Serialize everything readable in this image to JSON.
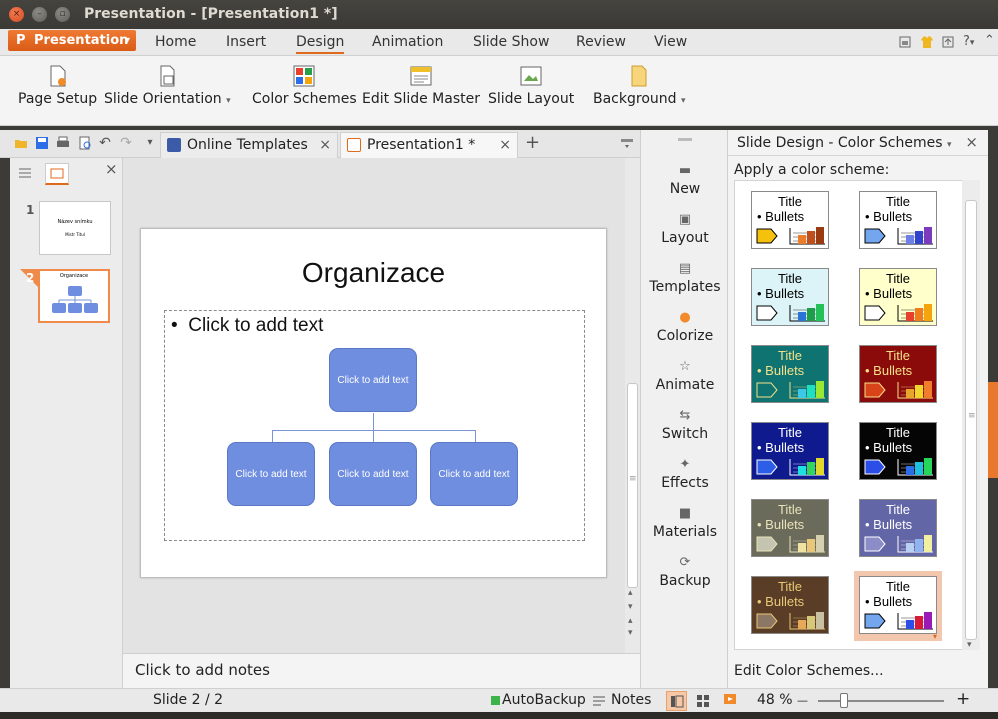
{
  "window": {
    "title": "Presentation - [Presentation1 *]",
    "close_glyph": "×",
    "min_glyph": "–",
    "max_glyph": "▫"
  },
  "menubar": {
    "app_button": "Presentation",
    "app_icon": "P",
    "app_arrow": "▾",
    "tabs": [
      "Home",
      "Insert",
      "Design",
      "Animation",
      "Slide Show",
      "Review",
      "View"
    ],
    "active_tab": "Design",
    "help_glyph": "?",
    "help_arrow": "▾",
    "collapse_glyph": "⌃"
  },
  "ribbon": {
    "buttons": [
      {
        "label": "Page Setup",
        "dropdown": false
      },
      {
        "label": "Slide Orientation",
        "dropdown": true
      },
      {
        "label": "Color Schemes",
        "dropdown": false
      },
      {
        "label": "Edit Slide Master",
        "dropdown": false
      },
      {
        "label": "Slide Layout",
        "dropdown": false
      },
      {
        "label": "Background",
        "dropdown": true
      }
    ],
    "dropdown_glyph": "▾"
  },
  "doc_tabs": {
    "tabs": [
      {
        "label": "Online Templates",
        "active": false
      },
      {
        "label": "Presentation1 *",
        "active": true
      }
    ],
    "close_glyph": "×",
    "new_tab_glyph": "+",
    "quick_access": {
      "undo": "↶",
      "redo": "↷",
      "more": "▾"
    }
  },
  "thumbnails": {
    "close_glyph": "×",
    "slides": [
      {
        "number": "1",
        "title": "Název snímku",
        "subtitle": "Mistr Titul"
      },
      {
        "number": "2",
        "title": "Organizace",
        "selected": true
      }
    ]
  },
  "slide": {
    "title": "Organizace",
    "bullet": "•",
    "body_text": "Click to add text",
    "org_boxes": [
      "Click to add text",
      "Click to add text",
      "Click to add text",
      "Click to add text"
    ],
    "shape_fill": "#6f8ee0"
  },
  "scroll": {
    "up": "▴",
    "down": "▾",
    "grip": "≡"
  },
  "notes": {
    "placeholder": "Click to add notes"
  },
  "side_tools": {
    "items": [
      "New",
      "Layout",
      "Templates",
      "Colorize",
      "Animate",
      "Switch",
      "Effects",
      "Materials",
      "Backup"
    ],
    "icons": [
      "▬",
      "▣",
      "▤",
      "●",
      "☆",
      "⇆",
      "✦",
      "■",
      "⟳"
    ],
    "grip": "▬"
  },
  "task_pane": {
    "title": "Slide Design - Color Schemes",
    "title_arrow": "▾",
    "close_glyph": "×",
    "subtitle": "Apply a color scheme:",
    "scheme_title": "Title",
    "scheme_bullets": "• Bullets",
    "edit_link": "Edit Color Schemes...",
    "selected_marker": "▾",
    "schemes": [
      {
        "bg": "#ffffff",
        "text": "#000000",
        "arrow": "#f4c20d",
        "bars": [
          "#e87d2b",
          "#c0501b",
          "#9a3a10"
        ]
      },
      {
        "bg": "#ffffff",
        "text": "#000000",
        "arrow": "#74a6f0",
        "bars": [
          "#6c80e8",
          "#3344cc",
          "#7b3bbd"
        ]
      },
      {
        "bg": "#dcf3f7",
        "text": "#000000",
        "arrow": "#ffffff",
        "bars": [
          "#2c73d6",
          "#1d9e4a",
          "#26c05a"
        ]
      },
      {
        "bg": "#ffffcc",
        "text": "#000000",
        "arrow": "#ffffff",
        "bars": [
          "#e8412b",
          "#f07d1c",
          "#f4a40d"
        ]
      },
      {
        "bg": "#0f7371",
        "text": "#f4e08a",
        "arrow": "#0f7371",
        "bars": [
          "#3ec8e8",
          "#1ee0c0",
          "#9be832"
        ]
      },
      {
        "bg": "#8b0a0a",
        "text": "#f4e08a",
        "arrow": "#d8431a",
        "bars": [
          "#e8a52b",
          "#f0d52b",
          "#f07d2b"
        ]
      },
      {
        "bg": "#0e1a8e",
        "text": "#ffffff",
        "arrow": "#2c5ee8",
        "bars": [
          "#1ee0e0",
          "#32d65a",
          "#e0d82b"
        ]
      },
      {
        "bg": "#050505",
        "text": "#ffffff",
        "arrow": "#2c4ee8",
        "bars": [
          "#2c6ee8",
          "#1ec0e0",
          "#26d65a"
        ]
      },
      {
        "bg": "#6b6b5c",
        "text": "#e8e2b8",
        "arrow": "#c4c4b0",
        "bars": [
          "#f0e2a0",
          "#e8c878",
          "#d6d0b0"
        ]
      },
      {
        "bg": "#6366a6",
        "text": "#ffffff",
        "arrow": "#8c8cc8",
        "bars": [
          "#b8d0f4",
          "#90b4f0",
          "#f0f0a0"
        ]
      },
      {
        "bg": "#5a3d26",
        "text": "#e8c878",
        "arrow": "#8c7664",
        "bars": [
          "#e8a85a",
          "#d6c878",
          "#c8c0a0"
        ]
      },
      {
        "bg": "#ffffff",
        "text": "#000000",
        "arrow": "#74a6f0",
        "bars": [
          "#2c4ee8",
          "#d8193a",
          "#9a1ab8"
        ],
        "selected": true
      }
    ]
  },
  "statusbar": {
    "slide_info": "Slide 2 / 2",
    "autobackup": "AutoBackup",
    "notes": "Notes",
    "zoom": "48 %",
    "zoom_minus": "—",
    "zoom_plus": "+",
    "zoom_level": 0.21
  },
  "colors": {
    "accent": "#e06a1c",
    "shape": "#6f8ee0",
    "selection": "#f08a4b"
  }
}
